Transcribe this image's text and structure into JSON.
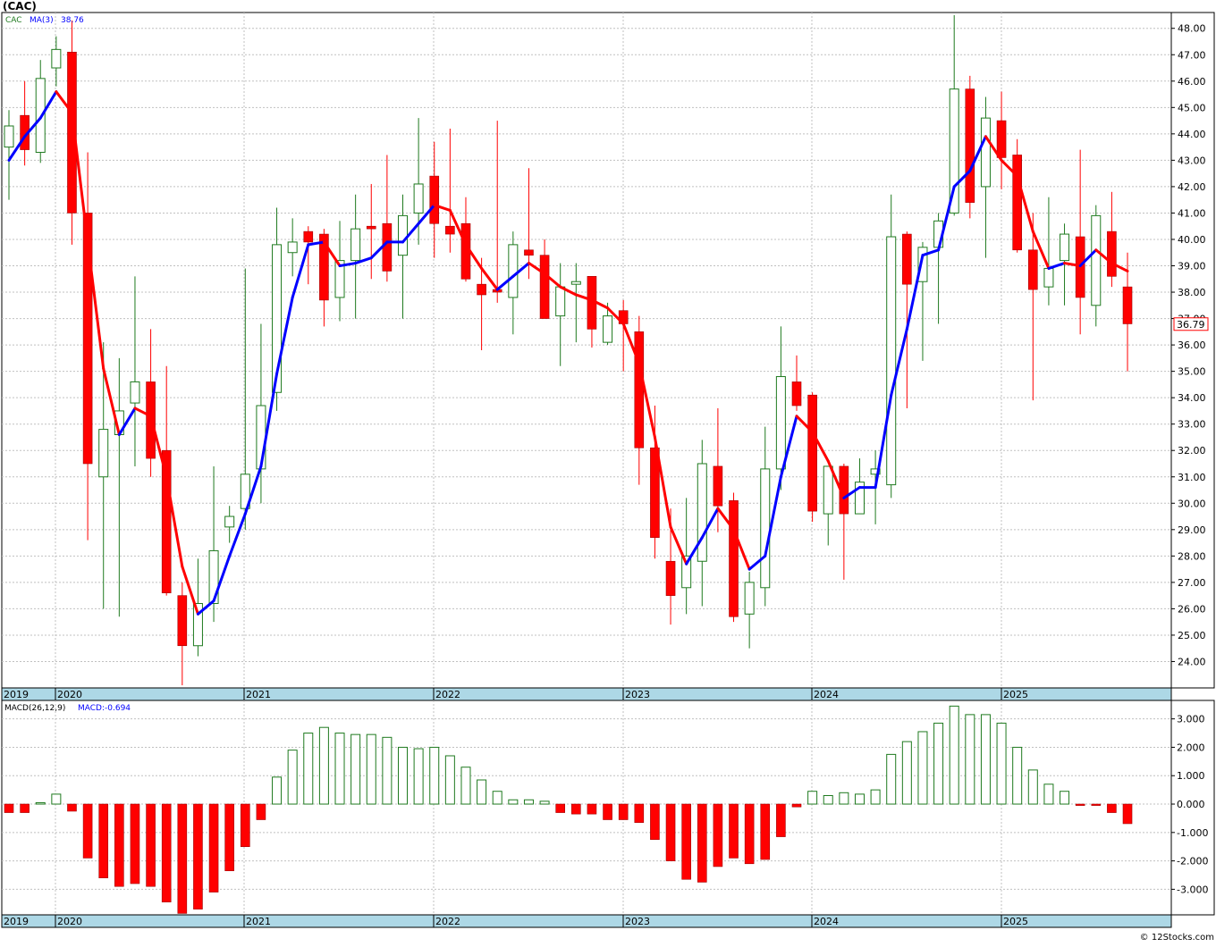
{
  "header": {
    "symbol_title": "(CAC)",
    "copyright": "© 12Stocks.com"
  },
  "chart_data": [
    {
      "type": "candlestick",
      "panel": "price",
      "legend": {
        "symbol": "CAC",
        "ma_label": "MA(3)",
        "ma_value": "38.76"
      },
      "last_price": "36.79",
      "ylim": [
        23.0,
        48.6
      ],
      "yticks": [
        24,
        25,
        26,
        27,
        28,
        29,
        30,
        31,
        32,
        33,
        34,
        35,
        36,
        37,
        38,
        39,
        40,
        41,
        42,
        43,
        44,
        45,
        46,
        47,
        48
      ],
      "ytick_labels": [
        "24.00",
        "25.00",
        "26.00",
        "27.00",
        "28.00",
        "29.00",
        "30.00",
        "31.00",
        "32.00",
        "33.00",
        "34.00",
        "35.00",
        "36.00",
        "37.00",
        "38.00",
        "39.00",
        "40.00",
        "41.00",
        "42.00",
        "43.00",
        "44.00",
        "45.00",
        "46.00",
        "47.00",
        "48.00"
      ],
      "x_labels": [
        "2019",
        "2020",
        "2021",
        "2022",
        "2023",
        "2024",
        "2025"
      ],
      "grid": true,
      "up_color": "#1f7a1f",
      "down_color": "#ff0000",
      "ma_up_color": "#0000ff",
      "ma_down_color": "#ff0000",
      "candles": [
        {
          "o": 43.5,
          "h": 44.9,
          "l": 41.5,
          "c": 44.3
        },
        {
          "o": 44.7,
          "h": 46.0,
          "l": 42.8,
          "c": 43.4
        },
        {
          "o": 43.3,
          "h": 46.8,
          "l": 42.9,
          "c": 46.1
        },
        {
          "o": 46.5,
          "h": 47.7,
          "l": 45.8,
          "c": 47.2
        },
        {
          "o": 47.1,
          "h": 48.3,
          "l": 39.8,
          "c": 41.0
        },
        {
          "o": 41.0,
          "h": 43.3,
          "l": 28.6,
          "c": 31.5
        },
        {
          "o": 31.0,
          "h": 36.1,
          "l": 26.0,
          "c": 32.8
        },
        {
          "o": 32.6,
          "h": 35.5,
          "l": 25.7,
          "c": 33.5
        },
        {
          "o": 33.8,
          "h": 38.6,
          "l": 31.4,
          "c": 34.6
        },
        {
          "o": 34.6,
          "h": 36.6,
          "l": 31.0,
          "c": 31.7
        },
        {
          "o": 32.0,
          "h": 35.2,
          "l": 26.5,
          "c": 26.6
        },
        {
          "o": 26.5,
          "h": 27.0,
          "l": 23.1,
          "c": 24.6
        },
        {
          "o": 24.6,
          "h": 27.9,
          "l": 24.2,
          "c": 26.2
        },
        {
          "o": 26.2,
          "h": 31.4,
          "l": 25.5,
          "c": 28.2
        },
        {
          "o": 29.1,
          "h": 29.9,
          "l": 28.5,
          "c": 29.5
        },
        {
          "o": 29.8,
          "h": 38.9,
          "l": 29.0,
          "c": 31.1
        },
        {
          "o": 31.3,
          "h": 36.8,
          "l": 30.0,
          "c": 33.7
        },
        {
          "o": 34.2,
          "h": 41.2,
          "l": 33.5,
          "c": 39.8
        },
        {
          "o": 39.5,
          "h": 40.8,
          "l": 38.6,
          "c": 39.9
        },
        {
          "o": 40.3,
          "h": 40.5,
          "l": 38.3,
          "c": 39.9
        },
        {
          "o": 40.2,
          "h": 40.4,
          "l": 36.7,
          "c": 37.7
        },
        {
          "o": 37.8,
          "h": 40.7,
          "l": 36.9,
          "c": 39.2
        },
        {
          "o": 39.2,
          "h": 41.7,
          "l": 37.0,
          "c": 40.4
        },
        {
          "o": 40.5,
          "h": 42.1,
          "l": 38.5,
          "c": 40.4
        },
        {
          "o": 40.6,
          "h": 43.2,
          "l": 38.4,
          "c": 38.8
        },
        {
          "o": 39.4,
          "h": 41.7,
          "l": 37.0,
          "c": 40.9
        },
        {
          "o": 41.0,
          "h": 44.6,
          "l": 39.8,
          "c": 42.1
        },
        {
          "o": 42.4,
          "h": 43.7,
          "l": 39.3,
          "c": 40.6
        },
        {
          "o": 40.5,
          "h": 44.2,
          "l": 39.5,
          "c": 40.2
        },
        {
          "o": 40.6,
          "h": 41.6,
          "l": 38.4,
          "c": 38.5
        },
        {
          "o": 38.3,
          "h": 39.3,
          "l": 35.8,
          "c": 37.9
        },
        {
          "o": 38.1,
          "h": 44.5,
          "l": 37.6,
          "c": 38.0
        },
        {
          "o": 37.8,
          "h": 40.3,
          "l": 36.4,
          "c": 39.8
        },
        {
          "o": 39.6,
          "h": 42.7,
          "l": 38.5,
          "c": 39.4
        },
        {
          "o": 39.4,
          "h": 40.0,
          "l": 37.0,
          "c": 37.0
        },
        {
          "o": 37.1,
          "h": 39.1,
          "l": 35.2,
          "c": 38.2
        },
        {
          "o": 38.3,
          "h": 39.1,
          "l": 36.1,
          "c": 38.4
        },
        {
          "o": 38.6,
          "h": 38.6,
          "l": 35.9,
          "c": 36.6
        },
        {
          "o": 36.1,
          "h": 37.6,
          "l": 36.0,
          "c": 37.1
        },
        {
          "o": 37.3,
          "h": 37.7,
          "l": 35.0,
          "c": 36.8
        },
        {
          "o": 36.5,
          "h": 37.1,
          "l": 30.7,
          "c": 32.1
        },
        {
          "o": 32.1,
          "h": 33.7,
          "l": 27.9,
          "c": 28.7
        },
        {
          "o": 27.8,
          "h": 29.8,
          "l": 25.4,
          "c": 26.5
        },
        {
          "o": 26.8,
          "h": 30.2,
          "l": 25.8,
          "c": 28.0
        },
        {
          "o": 27.8,
          "h": 32.4,
          "l": 26.1,
          "c": 31.5
        },
        {
          "o": 31.4,
          "h": 33.6,
          "l": 28.9,
          "c": 29.9
        },
        {
          "o": 30.1,
          "h": 30.4,
          "l": 25.5,
          "c": 25.7
        },
        {
          "o": 25.8,
          "h": 27.4,
          "l": 24.5,
          "c": 27.0
        },
        {
          "o": 26.8,
          "h": 32.9,
          "l": 26.1,
          "c": 31.3
        },
        {
          "o": 31.3,
          "h": 36.7,
          "l": 30.5,
          "c": 34.8
        },
        {
          "o": 34.6,
          "h": 35.6,
          "l": 33.5,
          "c": 33.7
        },
        {
          "o": 34.1,
          "h": 34.2,
          "l": 29.3,
          "c": 29.7
        },
        {
          "o": 29.6,
          "h": 31.4,
          "l": 28.4,
          "c": 31.4
        },
        {
          "o": 31.4,
          "h": 31.5,
          "l": 27.1,
          "c": 29.6
        },
        {
          "o": 29.6,
          "h": 31.7,
          "l": 29.6,
          "c": 30.8
        },
        {
          "o": 31.1,
          "h": 32.0,
          "l": 29.2,
          "c": 31.3
        },
        {
          "o": 30.7,
          "h": 41.7,
          "l": 30.2,
          "c": 40.1
        },
        {
          "o": 40.2,
          "h": 40.3,
          "l": 33.6,
          "c": 38.3
        },
        {
          "o": 38.4,
          "h": 39.9,
          "l": 35.4,
          "c": 39.7
        },
        {
          "o": 39.7,
          "h": 41.0,
          "l": 36.8,
          "c": 40.7
        },
        {
          "o": 41.0,
          "h": 48.5,
          "l": 40.9,
          "c": 45.7
        },
        {
          "o": 45.7,
          "h": 46.2,
          "l": 40.8,
          "c": 41.4
        },
        {
          "o": 42.0,
          "h": 45.4,
          "l": 39.3,
          "c": 44.6
        },
        {
          "o": 44.5,
          "h": 45.6,
          "l": 41.9,
          "c": 43.1
        },
        {
          "o": 43.2,
          "h": 43.8,
          "l": 39.5,
          "c": 39.6
        },
        {
          "o": 39.6,
          "h": 41.0,
          "l": 33.9,
          "c": 38.1
        },
        {
          "o": 38.2,
          "h": 41.6,
          "l": 37.5,
          "c": 38.9
        },
        {
          "o": 39.2,
          "h": 40.6,
          "l": 37.5,
          "c": 40.2
        },
        {
          "o": 40.1,
          "h": 43.4,
          "l": 36.4,
          "c": 37.8
        },
        {
          "o": 37.5,
          "h": 41.3,
          "l": 36.7,
          "c": 40.9
        },
        {
          "o": 40.3,
          "h": 41.8,
          "l": 38.2,
          "c": 38.6
        },
        {
          "o": 38.2,
          "h": 39.5,
          "l": 35.0,
          "c": 36.8
        }
      ],
      "ma3": [
        43.0,
        43.9,
        44.6,
        45.6,
        44.8,
        39.9,
        35.1,
        32.6,
        33.6,
        33.3,
        31.0,
        27.6,
        25.8,
        26.3,
        28.0,
        29.6,
        31.4,
        34.9,
        37.8,
        39.8,
        39.9,
        39.0,
        39.1,
        39.3,
        39.9,
        39.9,
        40.6,
        41.3,
        41.1,
        39.8,
        38.9,
        38.1,
        38.6,
        39.1,
        38.7,
        38.2,
        37.9,
        37.7,
        37.4,
        36.8,
        35.3,
        32.5,
        29.1,
        27.7,
        28.7,
        29.8,
        29.0,
        27.5,
        28.0,
        31.0,
        33.3,
        32.7,
        31.6,
        30.2,
        30.6,
        30.6,
        34.1,
        36.6,
        39.4,
        39.6,
        42.0,
        42.6,
        43.9,
        43.0,
        42.4,
        40.3,
        38.9,
        39.1,
        39.0,
        39.6,
        39.1,
        38.8
      ],
      "ma_start_index": 0
    },
    {
      "type": "bar",
      "panel": "macd",
      "legend": {
        "label": "MACD(26,12,9)",
        "value_label": "MACD:-0.694"
      },
      "ylim": [
        -3.9,
        3.65
      ],
      "yticks": [
        -3,
        -2,
        -1,
        0,
        1,
        2,
        3
      ],
      "ytick_labels": [
        "-3.000",
        "-2.000",
        "-1.000",
        "0.000",
        "1.000",
        "2.000",
        "3.000"
      ],
      "x_labels": [
        "2019",
        "2020",
        "2021",
        "2022",
        "2023",
        "2024",
        "2025"
      ],
      "grid": true,
      "positive_color": "#1f7a1f",
      "negative_color": "#ff0000",
      "values": [
        -0.3,
        -0.3,
        0.05,
        0.35,
        -0.25,
        -1.9,
        -2.6,
        -2.9,
        -2.8,
        -2.9,
        -3.45,
        -3.85,
        -3.7,
        -3.1,
        -2.35,
        -1.5,
        -0.55,
        0.95,
        1.9,
        2.5,
        2.7,
        2.5,
        2.45,
        2.45,
        2.35,
        2.0,
        1.95,
        2.0,
        1.7,
        1.3,
        0.85,
        0.45,
        0.15,
        0.15,
        0.1,
        -0.3,
        -0.35,
        -0.35,
        -0.55,
        -0.55,
        -0.65,
        -1.25,
        -2.0,
        -2.65,
        -2.75,
        -2.2,
        -1.9,
        -2.1,
        -1.95,
        -1.15,
        -0.1,
        0.45,
        0.3,
        0.4,
        0.35,
        0.5,
        1.75,
        2.2,
        2.55,
        2.85,
        3.45,
        3.15,
        3.15,
        2.85,
        2.0,
        1.2,
        0.7,
        0.45,
        -0.05,
        -0.05,
        -0.3,
        -0.69
      ]
    }
  ]
}
